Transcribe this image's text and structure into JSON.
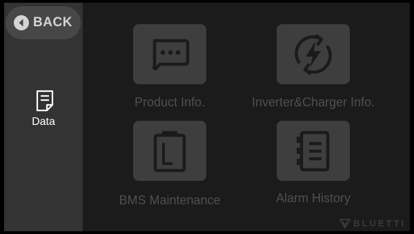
{
  "sidebar": {
    "back_label": "BACK",
    "items": [
      {
        "label": "Data",
        "icon": "document-icon",
        "active": true
      }
    ]
  },
  "tiles": [
    {
      "label": "Product Info.",
      "icon": "chat-bubble-icon"
    },
    {
      "label": "Inverter&Charger Info.",
      "icon": "lightning-cycle-icon"
    },
    {
      "label": "BMS Maintenance",
      "icon": "battery-icon"
    },
    {
      "label": "Alarm History",
      "icon": "notebook-icon"
    }
  ],
  "brand": {
    "name": "BLUETTI"
  },
  "colors": {
    "background": "#000000",
    "screen": "#1b1b1b",
    "sidebar": "#333333",
    "tile": "#3e3e3e",
    "tile_label": "#4f4f4f",
    "active_text": "#ffffff"
  }
}
